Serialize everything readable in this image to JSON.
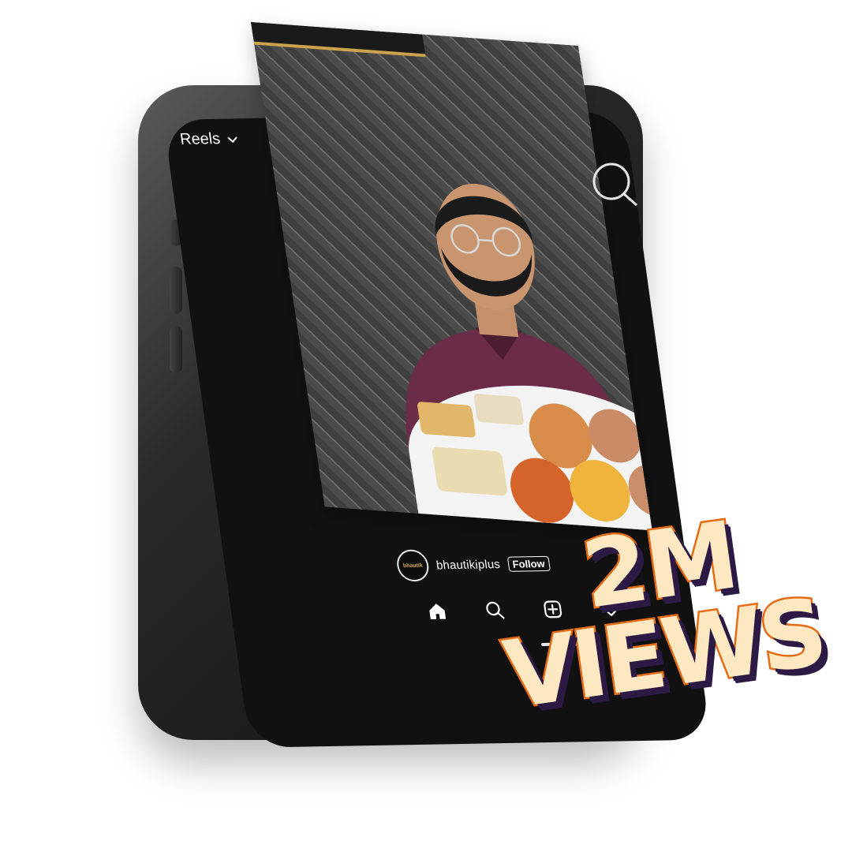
{
  "reels": {
    "header_label": "Reels"
  },
  "post": {
    "username": "bhautikiplus",
    "follow_label": "Follow",
    "avatar_text": "bhautik"
  },
  "promo": {
    "line1": "2M",
    "line2": "VIEWS"
  },
  "nav": {
    "items": [
      "home-icon",
      "search-icon",
      "add-icon",
      "heart-icon"
    ]
  },
  "colors": {
    "screen_bg": "#111111",
    "title_fill": "#fde8c2",
    "title_stroke": "#e46b14",
    "title_shadow": "#2c1a45"
  }
}
